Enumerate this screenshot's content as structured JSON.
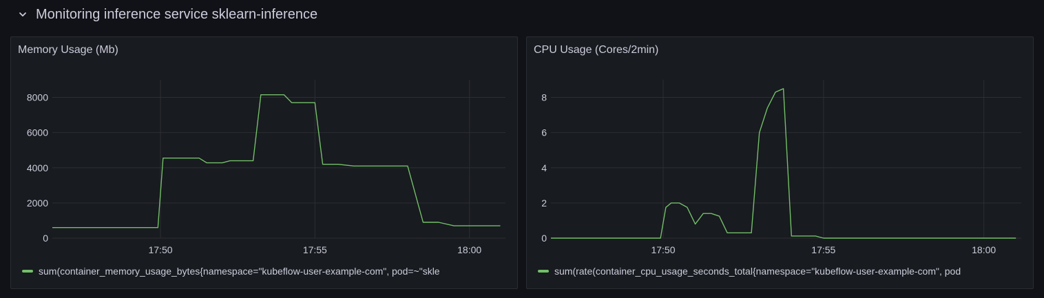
{
  "row": {
    "title": "Monitoring inference service sklearn-inference"
  },
  "colors": {
    "series": "#73bf69",
    "grid": "#2c2e33",
    "background": "#181b1f"
  },
  "panels": [
    {
      "title": "Memory Usage (Mb)",
      "legend": "sum(container_memory_usage_bytes{namespace=\"kubeflow-user-example-com\", pod=~\"skle"
    },
    {
      "title": "CPU Usage (Cores/2min)",
      "legend": "sum(rate(container_cpu_usage_seconds_total{namespace=\"kubeflow-user-example-com\", pod"
    }
  ],
  "chart_data": [
    {
      "type": "line",
      "title": "Memory Usage (Mb)",
      "xlabel": "",
      "ylabel": "",
      "x_ticks": [
        "17:50",
        "17:55",
        "18:00"
      ],
      "y_ticks": [
        0,
        2000,
        4000,
        6000,
        8000
      ],
      "xlim": [
        "17:46:30",
        "18:01:10"
      ],
      "ylim": [
        0,
        9000
      ],
      "grid": true,
      "legend_position": "bottom-left",
      "series": [
        {
          "name": "sum(container_memory_usage_bytes{namespace=\"kubeflow-user-example-com\", pod=~\"skle",
          "x": [
            "17:46:30",
            "17:47:30",
            "17:48:30",
            "17:49:30",
            "17:49:55",
            "17:50:05",
            "17:50:30",
            "17:51:00",
            "17:51:15",
            "17:51:30",
            "17:51:45",
            "17:52:00",
            "17:52:15",
            "17:52:45",
            "17:53:00",
            "17:53:15",
            "17:53:45",
            "17:54:00",
            "17:54:15",
            "17:54:45",
            "17:55:00",
            "17:55:15",
            "17:55:30",
            "17:55:45",
            "17:56:00",
            "17:56:15",
            "17:57:00",
            "17:57:30",
            "17:57:45",
            "17:58:00",
            "17:58:30",
            "17:58:45",
            "17:59:00",
            "17:59:30",
            "18:00:00",
            "18:00:30",
            "18:01:00"
          ],
          "values": [
            600,
            600,
            600,
            600,
            600,
            4550,
            4550,
            4550,
            4550,
            4280,
            4280,
            4280,
            4400,
            4400,
            4400,
            8150,
            8150,
            8150,
            7700,
            7700,
            7700,
            4200,
            4200,
            4200,
            4150,
            4100,
            4100,
            4100,
            4100,
            4100,
            900,
            900,
            900,
            700,
            700,
            700,
            700
          ]
        }
      ]
    },
    {
      "type": "line",
      "title": "CPU Usage (Cores/2min)",
      "xlabel": "",
      "ylabel": "",
      "x_ticks": [
        "17:50",
        "17:55",
        "18:00"
      ],
      "y_ticks": [
        0,
        2,
        4,
        6,
        8
      ],
      "xlim": [
        "17:46:30",
        "18:01:10"
      ],
      "ylim": [
        0,
        9
      ],
      "grid": true,
      "legend_position": "bottom-left",
      "series": [
        {
          "name": "sum(rate(container_cpu_usage_seconds_total{namespace=\"kubeflow-user-example-com\", pod",
          "x": [
            "17:46:30",
            "17:47:30",
            "17:48:30",
            "17:49:30",
            "17:49:55",
            "17:50:05",
            "17:50:15",
            "17:50:30",
            "17:50:45",
            "17:51:00",
            "17:51:15",
            "17:51:30",
            "17:51:45",
            "17:52:00",
            "17:52:15",
            "17:52:30",
            "17:52:45",
            "17:53:00",
            "17:53:15",
            "17:53:30",
            "17:53:45",
            "17:54:00",
            "17:54:15",
            "17:54:30",
            "17:54:45",
            "17:55:00",
            "17:55:30",
            "17:56:00",
            "17:57:00",
            "17:58:00",
            "17:59:00",
            "18:00:00",
            "18:01:00"
          ],
          "values": [
            0,
            0,
            0,
            0,
            0,
            1.75,
            2.0,
            2.0,
            1.75,
            0.8,
            1.4,
            1.4,
            1.25,
            0.3,
            0.3,
            0.3,
            0.3,
            6.0,
            7.4,
            8.3,
            8.5,
            0.12,
            0.12,
            0.12,
            0.12,
            0,
            0,
            0,
            0,
            0,
            0,
            0,
            0
          ]
        }
      ]
    }
  ]
}
